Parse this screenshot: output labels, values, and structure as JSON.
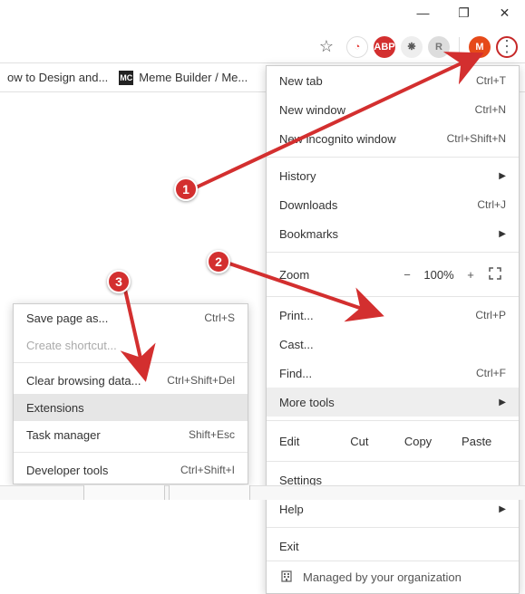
{
  "windowControls": {
    "minimize": "—",
    "maximize": "❐",
    "close": "✕"
  },
  "toolbar": {
    "extensions": [
      {
        "name": "ublock-icon",
        "glyph": "◔",
        "bg": "#fff",
        "color": "#e53935",
        "border": "1px solid #ddd"
      },
      {
        "name": "abp-icon",
        "glyph": "ABP",
        "bg": "#d32f2f",
        "color": "#fff"
      },
      {
        "name": "ext3-icon",
        "glyph": "❋",
        "bg": "#eee",
        "color": "#555"
      },
      {
        "name": "ext4-icon",
        "glyph": "R",
        "bg": "#ddd",
        "color": "#777"
      }
    ],
    "profileLetter": "M",
    "profileColor": "#e64a19"
  },
  "bookmarks": [
    {
      "label": "ow to Design and...",
      "icon": ""
    },
    {
      "label": "Meme Builder / Me...",
      "icon": "MC"
    }
  ],
  "mainMenu": {
    "newTab": {
      "label": "New tab",
      "shortcut": "Ctrl+T"
    },
    "newWindow": {
      "label": "New window",
      "shortcut": "Ctrl+N"
    },
    "newIncognito": {
      "label": "New incognito window",
      "shortcut": "Ctrl+Shift+N"
    },
    "history": {
      "label": "History"
    },
    "downloads": {
      "label": "Downloads",
      "shortcut": "Ctrl+J"
    },
    "bookmarksItem": {
      "label": "Bookmarks"
    },
    "zoom": {
      "label": "Zoom",
      "minus": "−",
      "pct": "100%",
      "plus": "+"
    },
    "print": {
      "label": "Print...",
      "shortcut": "Ctrl+P"
    },
    "cast": {
      "label": "Cast..."
    },
    "find": {
      "label": "Find...",
      "shortcut": "Ctrl+F"
    },
    "moreTools": {
      "label": "More tools"
    },
    "edit": {
      "label": "Edit",
      "cut": "Cut",
      "copy": "Copy",
      "paste": "Paste"
    },
    "settings": {
      "label": "Settings"
    },
    "help": {
      "label": "Help"
    },
    "exit": {
      "label": "Exit"
    },
    "managed": {
      "label": "Managed by your organization"
    }
  },
  "subMenu": {
    "savePage": {
      "label": "Save page as...",
      "shortcut": "Ctrl+S"
    },
    "createShortcut": {
      "label": "Create shortcut..."
    },
    "clearData": {
      "label": "Clear browsing data...",
      "shortcut": "Ctrl+Shift+Del"
    },
    "extensions": {
      "label": "Extensions"
    },
    "taskManager": {
      "label": "Task manager",
      "shortcut": "Shift+Esc"
    },
    "devTools": {
      "label": "Developer tools",
      "shortcut": "Ctrl+Shift+I"
    }
  },
  "badges": {
    "b1": "1",
    "b2": "2",
    "b3": "3"
  }
}
